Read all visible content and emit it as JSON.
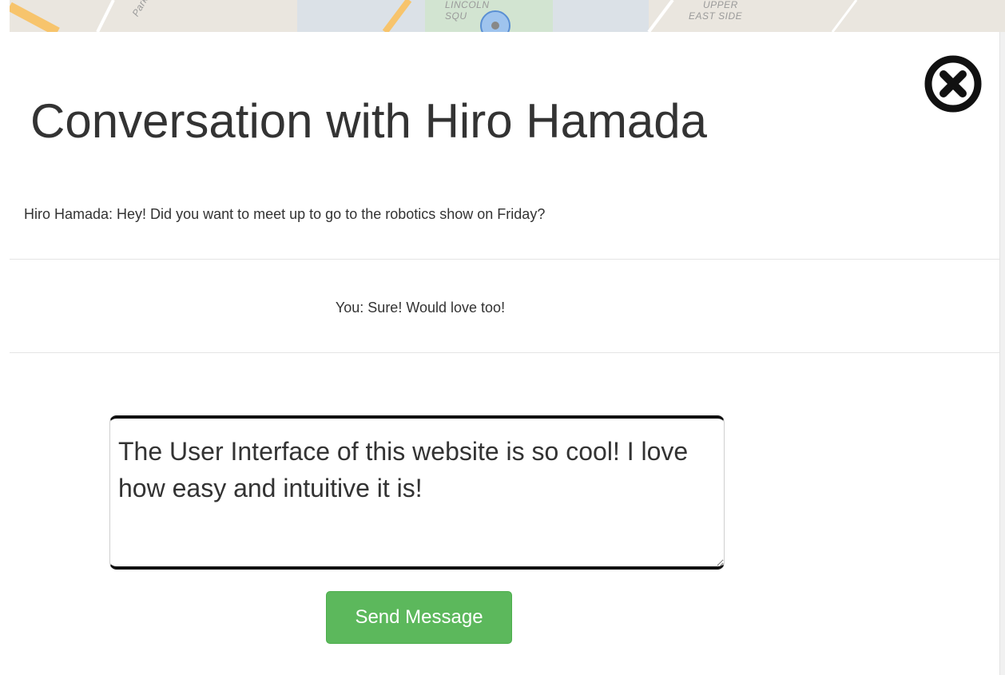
{
  "background_map": {
    "labels": [
      "Park",
      "LINCOLN",
      "SQU",
      "UPPER",
      "EAST SIDE"
    ]
  },
  "dialog": {
    "title": "Conversation with Hiro Hamada",
    "close_icon": "circle-x-icon",
    "messages": [
      {
        "text": "Hiro Hamada: Hey! Did you want to meet up to go to the robotics show on Friday?"
      },
      {
        "text": "You: Sure! Would love too!"
      }
    ],
    "composer": {
      "value": "The User Interface of this website is so cool! I love how easy and intuitive it is!"
    },
    "send_button_label": "Send Message"
  },
  "colors": {
    "send_button": "#5cb85c",
    "title_text": "#333333",
    "divider": "#e5e5e5",
    "map_background": "#eae6df"
  }
}
